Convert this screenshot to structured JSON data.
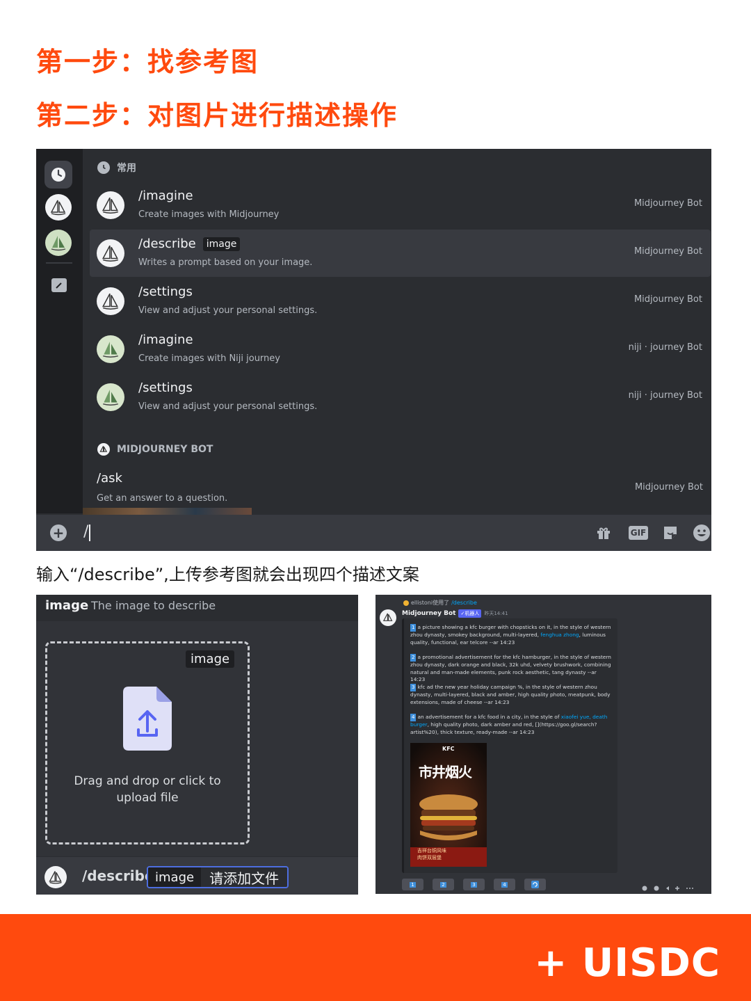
{
  "steps": {
    "step1": "第一步：找参考图",
    "step2": "第二步：对图片进行描述操作"
  },
  "palette": {
    "section_common": "常用",
    "section_mjbot": "MIDJOURNEY BOT",
    "commands": [
      {
        "name": "/imagine",
        "option": "",
        "description": "Create images with Midjourney",
        "bot": "Midjourney Bot",
        "avatar": "midjourney-boat-icon"
      },
      {
        "name": "/describe",
        "option": "image",
        "description": "Writes a prompt based on your image.",
        "bot": "Midjourney Bot",
        "avatar": "midjourney-boat-icon"
      },
      {
        "name": "/settings",
        "option": "",
        "description": "View and adjust your personal settings.",
        "bot": "Midjourney Bot",
        "avatar": "midjourney-boat-icon"
      },
      {
        "name": "/imagine",
        "option": "",
        "description": "Create images with Niji journey",
        "bot": "niji · journey Bot",
        "avatar": "niji-boat-icon"
      },
      {
        "name": "/settings",
        "option": "",
        "description": "View and adjust your personal settings.",
        "bot": "niji · journey Bot",
        "avatar": "niji-boat-icon"
      }
    ],
    "ask": {
      "name": "/ask",
      "description": "Get an answer to a question.",
      "bot": "Midjourney Bot"
    },
    "input_value": "/",
    "gif_label": "GIF",
    "colors": {
      "background": "#2b2d31",
      "rail": "#1e1f22",
      "input": "#383a40",
      "highlight": "#383a40"
    }
  },
  "caption": "输入“/describe”,上传参考图就会出现四个描述文案",
  "upload": {
    "header_name": "image",
    "header_desc": "The image to describe",
    "tag": "image",
    "drop_text_1": "Drag and drop or click to",
    "drop_text_2": "upload file",
    "command": "/describe",
    "pill_option": "image",
    "pill_value": "请添加文件"
  },
  "reply": {
    "reply_user": "ellistoni使用了",
    "reply_cmd": "/describe",
    "bot_name": "Midjourney Bot",
    "badge": "✓机器人",
    "time": "昨天14:41",
    "items": [
      {
        "n": "1",
        "pre": "a picture showing a kfc burger with chopsticks on it, in the style of western zhou dynasty, smokey background, multi-layered, ",
        "link": "fenghua zhong",
        "post": ", luminous quality, functional, ear telcore --ar 14:23"
      },
      {
        "n": "2",
        "pre": "a promotional advertisement for the kfc hamburger, in the style of western zhou dynasty, dark orange and black, 32k uhd, velvety brushwork, combining natural and man-made elements, punk rock aesthetic, tang dynasty --ar 14:23",
        "link": "",
        "post": ""
      },
      {
        "n": "3",
        "pre": "kfc ad the new year holiday campaign %, in the style of western zhou dynasty, multi-layered, black and amber, high quality photo, meatpunk, body extensions, made of cheese --ar 14:23",
        "link": "",
        "post": ""
      },
      {
        "n": "4",
        "pre": "an advertisement for a kfc food in a city, in the style of ",
        "link": "xiaofei yue, death burger",
        "post": ", high quality photo, dark amber and red, [](https://goo.gl/search?artist%20), thick texture, ready-made --ar 14:23"
      }
    ],
    "poster_brand": "KFC",
    "poster_title": "市井烟火",
    "poster_sub1": "吉祥台铜风味",
    "poster_sub2": "肉饼双层堡",
    "buttons": [
      "1",
      "2",
      "3",
      "4"
    ],
    "accent": "#3e8fdb"
  },
  "footer": {
    "brand": "+ UISDC",
    "color": "#ff4a0e"
  }
}
